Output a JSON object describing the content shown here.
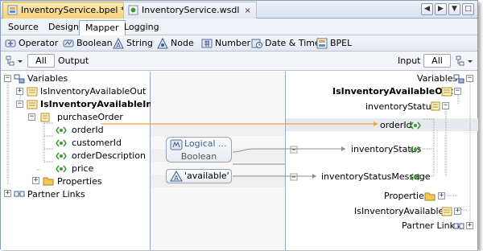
{
  "doc_tabs": [
    {
      "label": "InventoryService.bpel *",
      "close": "×",
      "active": true
    },
    {
      "label": "InventoryService.wsdl",
      "close": "×",
      "active": false
    }
  ],
  "window_buttons": [
    "◀",
    "▶",
    "▼",
    "□"
  ],
  "view_tabs": [
    "Source",
    "Design",
    "Mapper",
    "Logging"
  ],
  "active_view_tab": "Mapper",
  "palette": [
    "Operator",
    "Boolean",
    "String",
    "Node",
    "Number",
    "Date & Time",
    "BPEL"
  ],
  "header": {
    "left_filter": "All",
    "output_label": "Output",
    "input_label": "Input",
    "right_filter": "All"
  },
  "left_tree": {
    "variables": "Variables",
    "is_inventory_available_out": "IsInventoryAvailableOut",
    "is_inventory_available_in": "IsInventoryAvailableIn",
    "purchase_order": "purchaseOrder",
    "order_id": "orderId",
    "customer_id": "customerId",
    "order_description": "orderDescription",
    "price": "price",
    "properties": "Properties",
    "partner_links": "Partner Links"
  },
  "middle": {
    "logical_title": "Logical ...",
    "logical_sub": "Boolean",
    "string_literal": "'available'"
  },
  "right_tree": {
    "variables": "Variables",
    "is_inventory_available_out": "IsInventoryAvailableOut",
    "inventory_status_group": "inventoryStatus",
    "order_id": "orderId",
    "inventory_status": "inventoryStatus",
    "inventory_status_message": "inventoryStatusMessage",
    "properties": "Properties",
    "is_inventory_available_in": "IsInventoryAvailableIn",
    "partner_links": "Partner Links"
  },
  "colors": {
    "wire": "#f0a23c",
    "wire_grey": "#8c8c8c",
    "element_icon": "#3e9a35",
    "folder": "#f2c94c",
    "accent_tab": "#f6d27a"
  }
}
